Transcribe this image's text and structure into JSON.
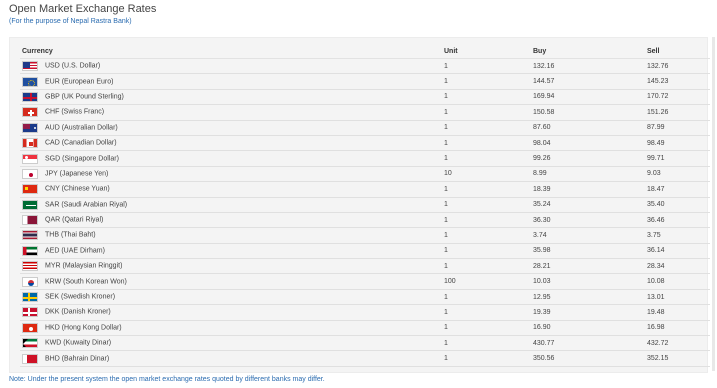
{
  "header": {
    "title": "Open Market Exchange Rates",
    "subtitle": "(For the purpose of Nepal Rastra Bank)"
  },
  "table": {
    "columns": [
      "Currency",
      "Unit",
      "Buy",
      "Sell"
    ],
    "rows": [
      {
        "flag": "us-flag-icon",
        "currency": "USD (U.S. Dollar)",
        "unit": "1",
        "buy": "132.16",
        "sell": "132.76"
      },
      {
        "flag": "eu-flag-icon",
        "currency": "EUR (European Euro)",
        "unit": "1",
        "buy": "144.57",
        "sell": "145.23"
      },
      {
        "flag": "uk-flag-icon",
        "currency": "GBP (UK Pound Sterling)",
        "unit": "1",
        "buy": "169.94",
        "sell": "170.72"
      },
      {
        "flag": "swiss-flag-icon",
        "currency": "CHF (Swiss Franc)",
        "unit": "1",
        "buy": "150.58",
        "sell": "151.26"
      },
      {
        "flag": "australia-flag-icon",
        "currency": "AUD (Australian Dollar)",
        "unit": "1",
        "buy": "87.60",
        "sell": "87.99"
      },
      {
        "flag": "canada-flag-icon",
        "currency": "CAD (Canadian Dollar)",
        "unit": "1",
        "buy": "98.04",
        "sell": "98.49"
      },
      {
        "flag": "singapore-flag-icon",
        "currency": "SGD (Singapore Dollar)",
        "unit": "1",
        "buy": "99.26",
        "sell": "99.71"
      },
      {
        "flag": "japan-flag-icon",
        "currency": "JPY (Japanese Yen)",
        "unit": "10",
        "buy": "8.99",
        "sell": "9.03"
      },
      {
        "flag": "china-flag-icon",
        "currency": "CNY (Chinese Yuan)",
        "unit": "1",
        "buy": "18.39",
        "sell": "18.47"
      },
      {
        "flag": "saudi-flag-icon",
        "currency": "SAR (Saudi Arabian Riyal)",
        "unit": "1",
        "buy": "35.24",
        "sell": "35.40"
      },
      {
        "flag": "qatar-flag-icon",
        "currency": "QAR (Qatari Riyal)",
        "unit": "1",
        "buy": "36.30",
        "sell": "36.46"
      },
      {
        "flag": "thailand-flag-icon",
        "currency": "THB (Thai Baht)",
        "unit": "1",
        "buy": "3.74",
        "sell": "3.75"
      },
      {
        "flag": "uae-flag-icon",
        "currency": "AED (UAE Dirham)",
        "unit": "1",
        "buy": "35.98",
        "sell": "36.14"
      },
      {
        "flag": "malaysia-flag-icon",
        "currency": "MYR (Malaysian Ringgit)",
        "unit": "1",
        "buy": "28.21",
        "sell": "28.34"
      },
      {
        "flag": "korea-flag-icon",
        "currency": "KRW (South Korean Won)",
        "unit": "100",
        "buy": "10.03",
        "sell": "10.08"
      },
      {
        "flag": "sweden-flag-icon",
        "currency": "SEK (Swedish Kroner)",
        "unit": "1",
        "buy": "12.95",
        "sell": "13.01"
      },
      {
        "flag": "denmark-flag-icon",
        "currency": "DKK (Danish Kroner)",
        "unit": "1",
        "buy": "19.39",
        "sell": "19.48"
      },
      {
        "flag": "hongkong-flag-icon",
        "currency": "HKD (Hong Kong Dollar)",
        "unit": "1",
        "buy": "16.90",
        "sell": "16.98"
      },
      {
        "flag": "kuwait-flag-icon",
        "currency": "KWD (Kuwaity Dinar)",
        "unit": "1",
        "buy": "430.77",
        "sell": "432.72"
      },
      {
        "flag": "bahrain-flag-icon",
        "currency": "BHD (Bahrain Dinar)",
        "unit": "1",
        "buy": "350.56",
        "sell": "352.15"
      }
    ]
  },
  "note": "Note: Under the present system the open market exchange rates quoted by different banks may differ."
}
